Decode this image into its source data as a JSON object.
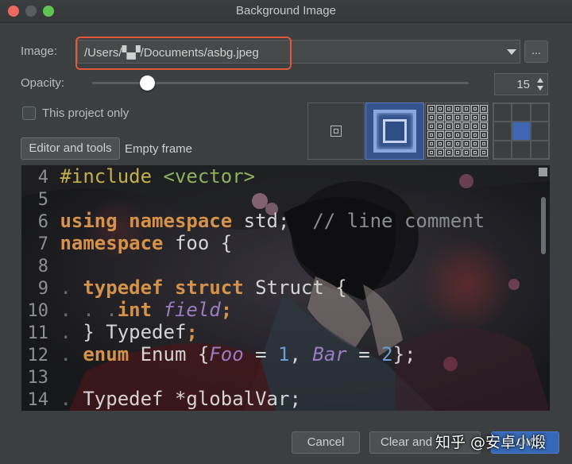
{
  "window": {
    "title": "Background Image"
  },
  "image": {
    "label": "Image:",
    "path": "/Users/▚▞/Documents/asbg.jpeg",
    "browse_label": "..."
  },
  "opacity": {
    "label": "Opacity:",
    "value": "15",
    "fraction": 0.15
  },
  "project_only": {
    "label": "This project only",
    "checked": false
  },
  "tabs": {
    "editor": "Editor and tools",
    "empty_frame": "Empty frame"
  },
  "fill_modes": [
    "center-icon",
    "scale-icon",
    "tile-icon"
  ],
  "anchor": {
    "selected_row": 1,
    "selected_col": 1
  },
  "code_lines": [
    {
      "n": "4"
    },
    {
      "n": "5"
    },
    {
      "n": "6"
    },
    {
      "n": "7"
    },
    {
      "n": "8"
    },
    {
      "n": "9"
    },
    {
      "n": "10"
    },
    {
      "n": "11"
    },
    {
      "n": "12"
    },
    {
      "n": "13"
    },
    {
      "n": "14"
    }
  ],
  "code": {
    "l4a": "#include",
    "l4b": " <vector>",
    "l6a": "using",
    "l6b": " namespace",
    "l6c": " std;",
    "l6d": "  // line comment",
    "l7a": "namespace",
    "l7b": " foo {",
    "l9a": "typedef",
    "l9b": " struct",
    "l9c": " Struct {",
    "l10a": "int",
    "l10b": " field",
    "l10c": ";",
    "l11a": "} Typedef",
    "l11b": ";",
    "l12a": "enum",
    "l12b": " Enum {",
    "l12c": "Foo",
    "l12d": " = ",
    "l12e": "1",
    "l12f": ", ",
    "l12g": "Bar",
    "l12h": " = ",
    "l12i": "2",
    "l12j": "};",
    "l14a": "Typedef *globalVar;"
  },
  "buttons": {
    "cancel": "Cancel",
    "clear": "Clear and",
    "ok": "OK"
  },
  "watermark": "知乎 @安卓小煅",
  "colors": {
    "accent": "#3669b8",
    "highlight_box": "#e05a3a",
    "keyword": "#d7924a",
    "string": "#8fb15a"
  }
}
